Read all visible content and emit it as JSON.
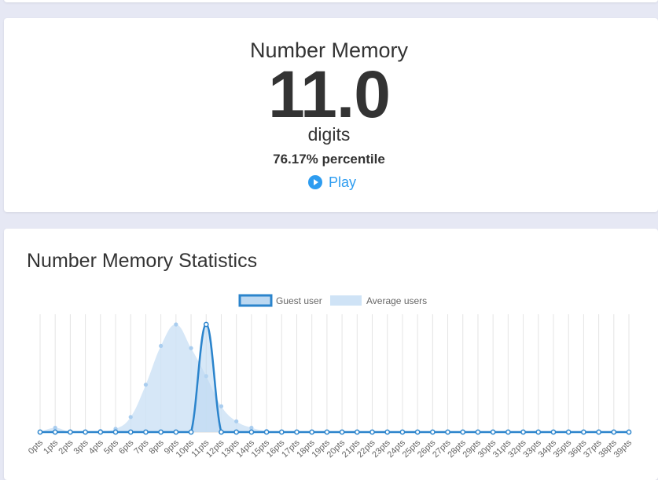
{
  "score_card": {
    "test_name": "Number Memory",
    "score": "11.0",
    "unit": "digits",
    "percentile": "76.17% percentile",
    "play_label": "Play",
    "play_icon": "play-circle-icon"
  },
  "stats": {
    "heading": "Number Memory Statistics"
  },
  "colors": {
    "accent": "#2b84cc",
    "link": "#2d9cf0",
    "average_fill": "#cfe3f6",
    "guest_fill": "#bcd8f1"
  },
  "chart_data": {
    "type": "area",
    "categories": [
      "0pts",
      "1pts",
      "2pts",
      "3pts",
      "4pts",
      "5pts",
      "6pts",
      "7pts",
      "8pts",
      "9pts",
      "10pts",
      "11pts",
      "12pts",
      "13pts",
      "14pts",
      "15pts",
      "16pts",
      "17pts",
      "18pts",
      "19pts",
      "20pts",
      "21pts",
      "22pts",
      "23pts",
      "24pts",
      "25pts",
      "26pts",
      "27pts",
      "28pts",
      "29pts",
      "30pts",
      "31pts",
      "32pts",
      "33pts",
      "34pts",
      "35pts",
      "36pts",
      "37pts",
      "38pts",
      "39pts"
    ],
    "series": [
      {
        "name": "Guest user",
        "values": [
          0,
          0,
          0,
          0,
          0,
          0,
          0,
          0,
          0,
          0,
          0,
          1,
          0,
          0,
          0,
          0,
          0,
          0,
          0,
          0,
          0,
          0,
          0,
          0,
          0,
          0,
          0,
          0,
          0,
          0,
          0,
          0,
          0,
          0,
          0,
          0,
          0,
          0,
          0,
          0
        ]
      },
      {
        "name": "Average users",
        "values": [
          0,
          0.04,
          0,
          0,
          0.01,
          0.03,
          0.14,
          0.44,
          0.8,
          1,
          0.78,
          0.52,
          0.24,
          0.1,
          0.04,
          0.01,
          0.005,
          0,
          0,
          0,
          0,
          0,
          0,
          0,
          0,
          0,
          0,
          0,
          0,
          0,
          0,
          0,
          0,
          0,
          0,
          0,
          0,
          0,
          0,
          0
        ]
      }
    ],
    "ylim": [
      0,
      1
    ],
    "grid": true,
    "legend": "top-center"
  }
}
